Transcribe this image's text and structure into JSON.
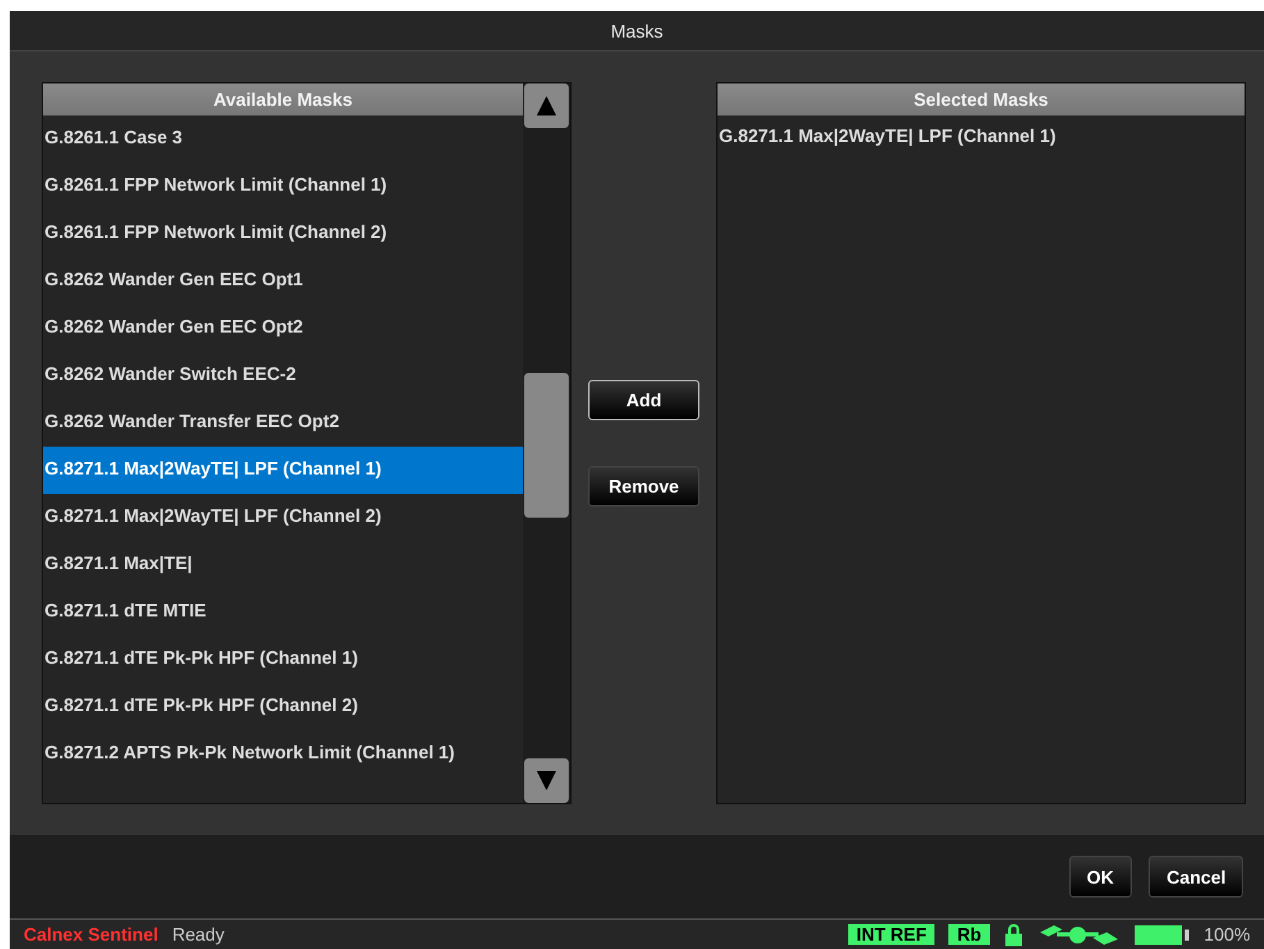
{
  "window": {
    "title": "Masks"
  },
  "available": {
    "header": "Available Masks",
    "items": [
      {
        "label": "G.8261.1 Case 3",
        "selected": false
      },
      {
        "label": "G.8261.1 FPP Network Limit (Channel 1)",
        "selected": false
      },
      {
        "label": "G.8261.1 FPP Network Limit (Channel 2)",
        "selected": false
      },
      {
        "label": "G.8262 Wander Gen EEC Opt1",
        "selected": false
      },
      {
        "label": "G.8262 Wander Gen EEC Opt2",
        "selected": false
      },
      {
        "label": "G.8262 Wander Switch EEC-2",
        "selected": false
      },
      {
        "label": "G.8262 Wander Transfer EEC Opt2",
        "selected": false
      },
      {
        "label": "G.8271.1 Max|2WayTE| LPF (Channel 1)",
        "selected": true
      },
      {
        "label": "G.8271.1 Max|2WayTE| LPF (Channel 2)",
        "selected": false
      },
      {
        "label": "G.8271.1 Max|TE|",
        "selected": false
      },
      {
        "label": "G.8271.1 dTE MTIE",
        "selected": false
      },
      {
        "label": "G.8271.1 dTE Pk-Pk HPF (Channel 1)",
        "selected": false
      },
      {
        "label": "G.8271.1 dTE Pk-Pk HPF (Channel 2)",
        "selected": false
      },
      {
        "label": "G.8271.2 APTS Pk-Pk Network Limit (Channel 1)",
        "selected": false
      }
    ]
  },
  "transfer_buttons": [
    "Add",
    "Remove"
  ],
  "selected": {
    "header": "Selected Masks",
    "items": [
      {
        "label": "G.8271.1 Max|2WayTE| LPF (Channel 1)"
      }
    ]
  },
  "dialog_buttons": [
    "OK",
    "Cancel"
  ],
  "status_bar": {
    "app": "Calnex Sentinel",
    "status": "Ready",
    "badges": [
      "INT REF",
      "Rb"
    ],
    "battery": "100%"
  }
}
